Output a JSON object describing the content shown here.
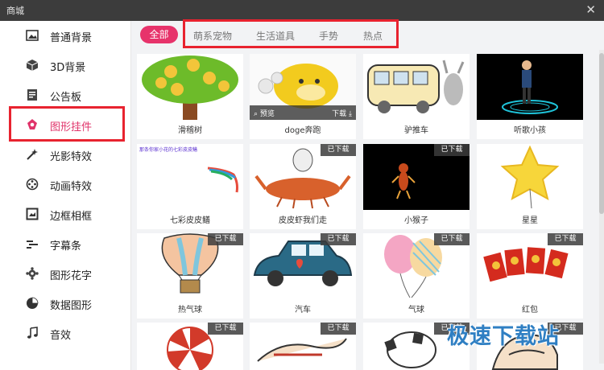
{
  "window": {
    "title": "商城",
    "close_symbol": "✕"
  },
  "sidebar": {
    "items": [
      {
        "label": "普通背景",
        "icon": "image-icon"
      },
      {
        "label": "3D背景",
        "icon": "cube-icon"
      },
      {
        "label": "公告板",
        "icon": "board-icon"
      },
      {
        "label": "图形挂件",
        "icon": "shapes-icon",
        "active": true
      },
      {
        "label": "光影特效",
        "icon": "magic-wand-icon"
      },
      {
        "label": "动画特效",
        "icon": "film-reel-icon"
      },
      {
        "label": "边框相框",
        "icon": "frame-icon"
      },
      {
        "label": "字幕条",
        "icon": "subtitle-icon"
      },
      {
        "label": "图形花字",
        "icon": "gear-flower-icon"
      },
      {
        "label": "数据图形",
        "icon": "pie-chart-icon"
      },
      {
        "label": "音效",
        "icon": "music-note-icon"
      }
    ]
  },
  "tabs": {
    "all": "全部",
    "items": [
      "萌系宠物",
      "生活道具",
      "手势",
      "热点"
    ]
  },
  "overlay": {
    "preview": "预览",
    "download": "下载"
  },
  "badge_text": "已下载",
  "cards": [
    {
      "label": "滑稽树"
    },
    {
      "label": "doge奔跑"
    },
    {
      "label": "驴推车"
    },
    {
      "label": "听歌小孩"
    },
    {
      "label": "七彩皮皮鳝"
    },
    {
      "label": "皮皮虾我们走"
    },
    {
      "label": "小猴子"
    },
    {
      "label": "星星"
    },
    {
      "label": "热气球"
    },
    {
      "label": "汽车"
    },
    {
      "label": "气球"
    },
    {
      "label": "红包"
    },
    {
      "label": ""
    },
    {
      "label": ""
    },
    {
      "label": ""
    },
    {
      "label": ""
    }
  ],
  "card5_caption": "那条你家小花的七彩皮皮鳝",
  "watermark": "极速下载站",
  "colors": {
    "accent": "#e7336b",
    "highlight_box": "#e8232f",
    "titlebar": "#3c3c3c"
  }
}
